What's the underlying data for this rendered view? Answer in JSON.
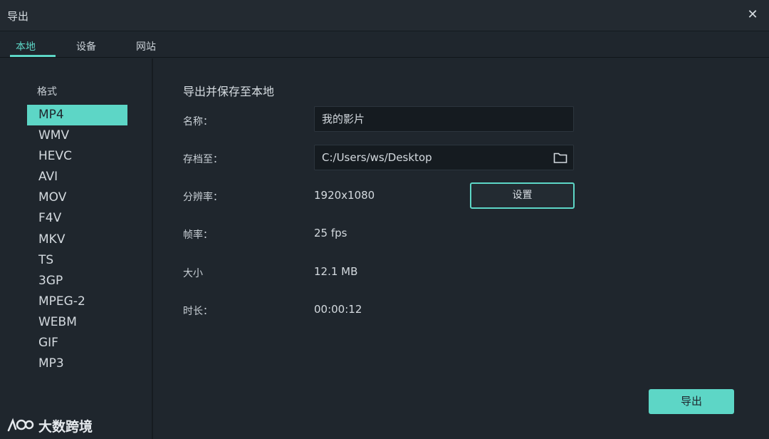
{
  "window": {
    "title": "导出"
  },
  "tabs": [
    {
      "label": "本地"
    },
    {
      "label": "设备"
    },
    {
      "label": "网站"
    }
  ],
  "formats": {
    "label": "格式",
    "selected": "MP4",
    "items": [
      "MP4",
      "WMV",
      "HEVC",
      "AVI",
      "MOV",
      "F4V",
      "MKV",
      "TS",
      "3GP",
      "MPEG-2",
      "WEBM",
      "GIF",
      "MP3"
    ]
  },
  "main": {
    "section_title": "导出并保存至本地",
    "name_label": "名称：",
    "name_value": "我的影片",
    "save_label": "存档至：",
    "save_value": "C:/Users/ws/Desktop",
    "resolution_label": "分辨率：",
    "resolution_value": "1920x1080",
    "settings_button": "设置",
    "framerate_label": "帧率：",
    "framerate_value": "25 fps",
    "size_label": "大小",
    "size_value": "12.1 MB",
    "duration_label": "时长：",
    "duration_value": "00:00:12",
    "export_button": "导出"
  },
  "watermark": {
    "text": "大数跨境"
  },
  "colors": {
    "accent": "#5dd6c6",
    "background": "#1f262d",
    "input_bg": "#151b20"
  },
  "icons": {
    "close": "close-icon",
    "folder": "folder-icon"
  }
}
